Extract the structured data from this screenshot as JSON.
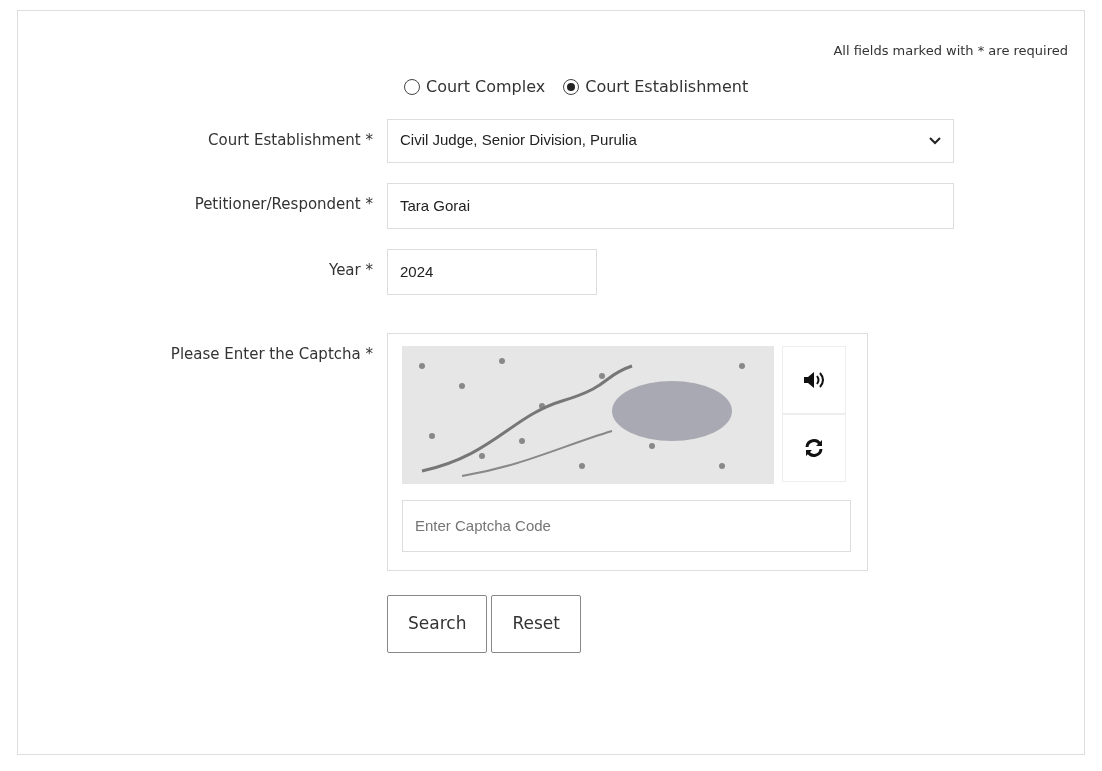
{
  "required_note": "All fields marked with * are required",
  "search_type": [
    {
      "label": "Court Complex",
      "selected": false
    },
    {
      "label": "Court Establishment",
      "selected": true
    }
  ],
  "fields": [
    {
      "kind": "select",
      "label": "Court Establishment *",
      "value": "Civil Judge, Senior Division, Purulia"
    },
    {
      "kind": "text",
      "label": "Petitioner/Respondent *",
      "value": "Tara Gorai"
    },
    {
      "kind": "short",
      "label": "Year *",
      "value": "2024"
    }
  ],
  "captcha": {
    "label": "Please Enter the Captcha *",
    "placeholder": "Enter Captcha Code"
  },
  "buttons": [
    "Search",
    "Reset"
  ]
}
